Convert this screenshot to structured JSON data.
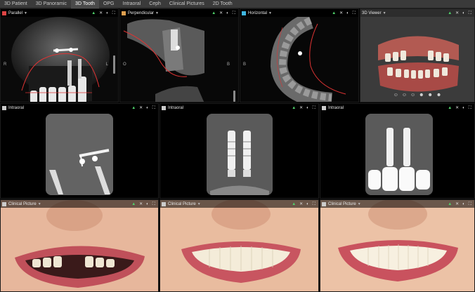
{
  "tabs": [
    "3D Patient",
    "3D Panoramic",
    "3D Tooth",
    "OPG",
    "Intraoral",
    "Ceph",
    "Clinical Pictures",
    "2D Tooth"
  ],
  "active_tab": "3D Tooth",
  "panels": {
    "parallel": {
      "title": "Parallel",
      "color": "#e04444",
      "left_label": "R",
      "right_label": "L"
    },
    "perpendicular": {
      "title": "Perpendicular",
      "color": "#e0a050",
      "left_label": "O",
      "right_label": "B"
    },
    "horizontal": {
      "title": "Horizontal",
      "color": "#3fb6e0",
      "left_label": "B"
    },
    "viewer3d": {
      "title": "3D Viewer"
    },
    "intraoral": [
      "Intraoral",
      "Intraoral",
      "Intraoral"
    ],
    "clinical": [
      "Clinical Picture",
      "Clinical Picture",
      "Clinical Picture"
    ]
  },
  "tool_icons": {
    "cursor": "▲",
    "cross": "✕",
    "contrast": "◐",
    "expand": "⛶"
  },
  "viewer_buttons": [
    "☺",
    "☺",
    "☺",
    "☻",
    "☻",
    "☻"
  ]
}
